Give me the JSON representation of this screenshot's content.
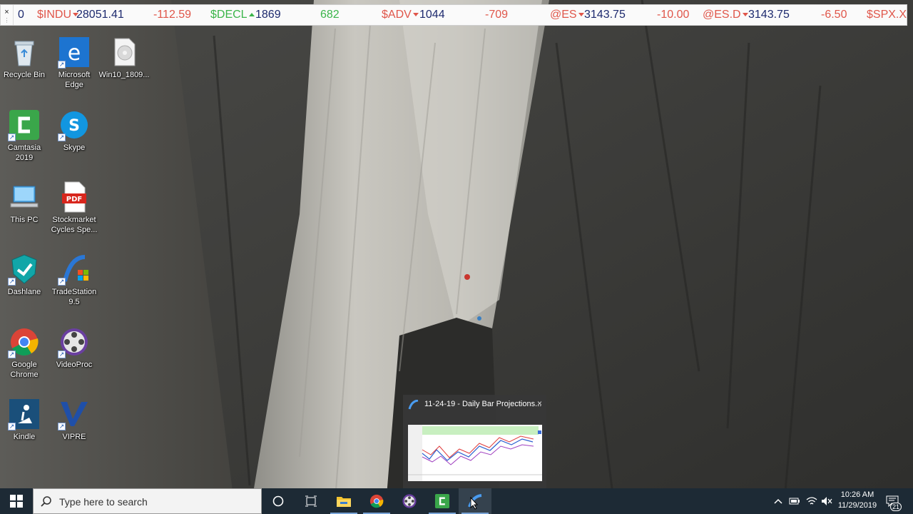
{
  "ticker": {
    "close_symbol": "×",
    "grip_symbol": "⋮",
    "items": [
      {
        "type": "val",
        "text": "0"
      },
      {
        "type": "sym",
        "text": "$INDU"
      },
      {
        "type": "val",
        "text": "28051.41"
      },
      {
        "type": "neg",
        "text": "-112.59"
      },
      {
        "type": "symg",
        "text": "$DECL"
      },
      {
        "type": "val",
        "text": "1869"
      },
      {
        "type": "pos",
        "text": "682"
      },
      {
        "type": "sym",
        "text": "$ADV"
      },
      {
        "type": "val",
        "text": "1044"
      },
      {
        "type": "neg",
        "text": "-709"
      },
      {
        "type": "sym",
        "text": "@ES"
      },
      {
        "type": "val",
        "text": "3143.75"
      },
      {
        "type": "neg",
        "text": "-10.00"
      },
      {
        "type": "sym",
        "text": "@ES.D"
      },
      {
        "type": "val",
        "text": "3143.75"
      },
      {
        "type": "neg",
        "text": "-6.50"
      },
      {
        "type": "sym",
        "text": "$SPX.X"
      }
    ]
  },
  "desktop_icons": [
    {
      "label": "Recycle Bin",
      "icon": "recycle-bin-icon"
    },
    {
      "label": "Microsoft Edge",
      "icon": "edge-icon"
    },
    {
      "label": "Win10_1809...",
      "icon": "disc-image-icon"
    },
    {
      "label": "Camtasia 2019",
      "icon": "camtasia-icon"
    },
    {
      "label": "Skype",
      "icon": "skype-icon"
    },
    {
      "label": "This PC",
      "icon": "this-pc-icon"
    },
    {
      "label": "Stockmarket Cycles Spe...",
      "icon": "pdf-icon"
    },
    {
      "label": "Dashlane",
      "icon": "dashlane-icon"
    },
    {
      "label": "TradeStation 9.5",
      "icon": "tradestation-icon"
    },
    {
      "label": "Google Chrome",
      "icon": "chrome-icon"
    },
    {
      "label": "VideoProc",
      "icon": "videoproc-icon"
    },
    {
      "label": "Kindle",
      "icon": "kindle-icon"
    },
    {
      "label": "VIPRE",
      "icon": "vipre-icon"
    }
  ],
  "preview": {
    "title": "11-24-19 - Daily Bar Projections...",
    "close_symbol": "×"
  },
  "taskbar": {
    "search_placeholder": "Type here to search",
    "time": "10:26 AM",
    "date": "11/29/2019",
    "notification_count": "21",
    "colors": {
      "bar": "#1d2a35",
      "active_indicator": "#78a3d6"
    }
  }
}
